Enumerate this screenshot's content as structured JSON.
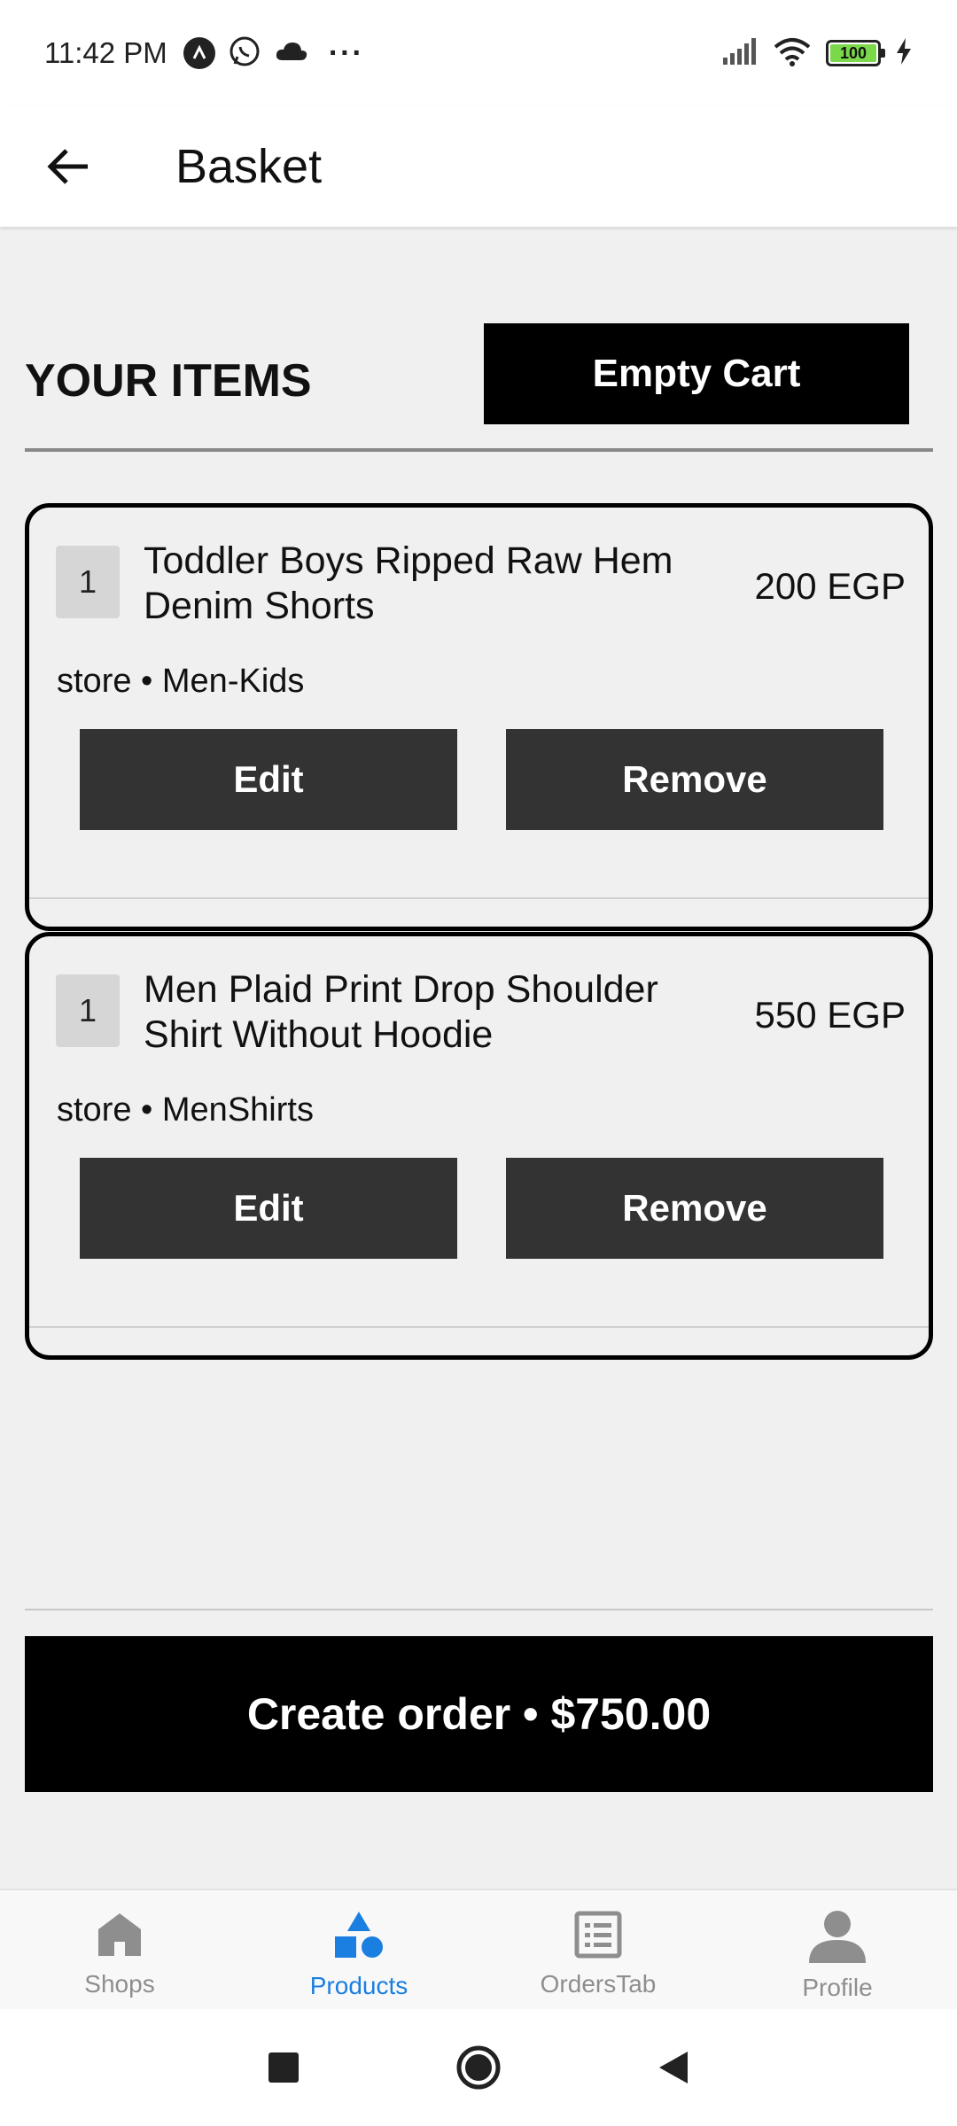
{
  "status_bar": {
    "time": "11:42 PM",
    "overflow": "···",
    "battery": "100"
  },
  "header": {
    "title": "Basket"
  },
  "cart": {
    "section_title": "YOUR ITEMS",
    "empty_cart_label": "Empty Cart",
    "items": [
      {
        "quantity": "1",
        "name": "Toddler Boys Ripped Raw Hem Denim Shorts",
        "price": "200 EGP",
        "meta": "store • Men-Kids",
        "edit_label": "Edit",
        "remove_label": "Remove"
      },
      {
        "quantity": "1",
        "name": "Men Plaid Print Drop Shoulder Shirt Without Hoodie",
        "price": "550 EGP",
        "meta": "store • MenShirts",
        "edit_label": "Edit",
        "remove_label": "Remove"
      }
    ],
    "create_order_label": "Create order • $750.00"
  },
  "tabs": [
    {
      "label": "Shops",
      "icon": "home-icon",
      "active": false
    },
    {
      "label": "Products",
      "icon": "shapes-icon",
      "active": true
    },
    {
      "label": "OrdersTab",
      "icon": "list-icon",
      "active": false
    },
    {
      "label": "Profile",
      "icon": "person-icon",
      "active": false
    }
  ],
  "colors": {
    "accent": "#1a7fe0",
    "inactive_tab": "#8e8e8e",
    "button_dark": "#333333",
    "primary_button": "#000000",
    "background": "#f0f0f0"
  }
}
